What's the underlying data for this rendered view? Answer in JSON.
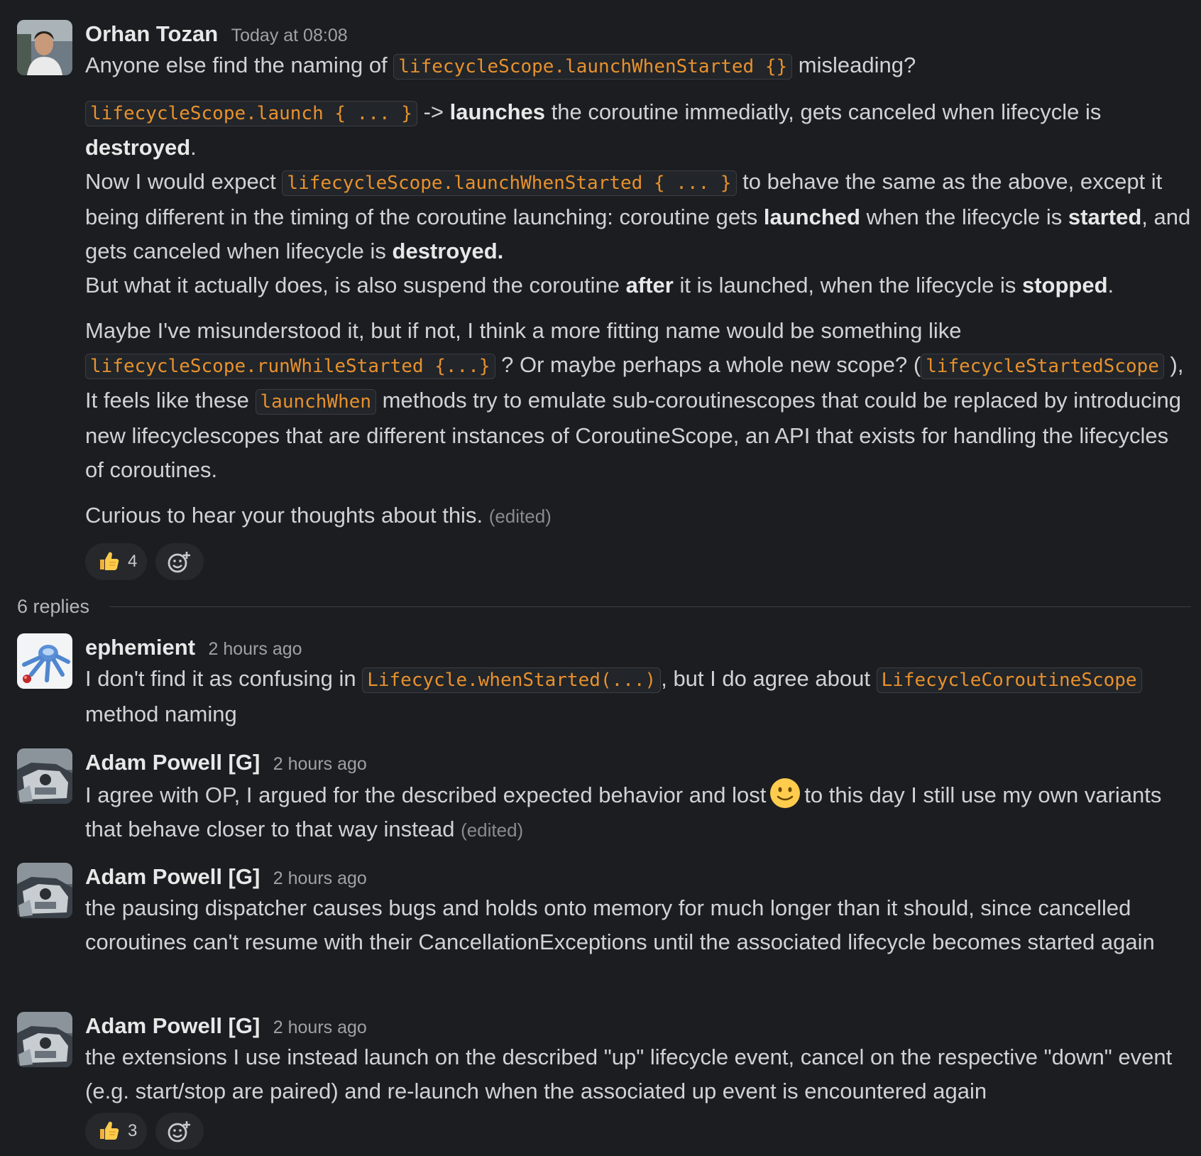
{
  "messages": [
    {
      "author": "Orhan Tozan",
      "timestamp": "Today at 08:08",
      "p1": {
        "t1": "Anyone else find the naming of ",
        "c1": "lifecycleScope.launchWhenStarted {}",
        "t2": " misleading?"
      },
      "p2": {
        "c1": "lifecycleScope.launch { ... }",
        "t1": " -> ",
        "b1": "launches",
        "t2": " the coroutine immediatly, gets canceled when lifecycle is ",
        "b2": "destroyed",
        "t3": ".",
        "t4": "Now I would expect ",
        "c2": "lifecycleScope.launchWhenStarted { ... }",
        "t5": " to behave the same as the above, except it being different in the timing of the coroutine launching: coroutine gets ",
        "b3": "launched",
        "t6": " when the lifecycle is ",
        "b4": "started",
        "t7": ", and gets canceled when lifecycle is ",
        "b5": "destroyed.",
        "t8": "But what it actually does, is also suspend the coroutine ",
        "b6": "after",
        "t9": " it is launched, when the lifecycle is ",
        "b7": "stopped",
        "t10": "."
      },
      "p3": {
        "t1": "Maybe I've misunderstood it, but if not, I think a more fitting name would be something like ",
        "c1": "lifecycleScope.runWhileStarted {...}",
        "t2": " ? Or maybe perhaps a whole new scope? (",
        "c2": "lifecycleStartedScope",
        "t3": " ), It feels like these ",
        "c3": "launchWhen",
        "t4": " methods  try to emulate sub-coroutinescopes that could be replaced by introducing new lifecyclescopes that are different instances of CoroutineScope, an API that exists for handling the lifecycles of coroutines."
      },
      "p4": {
        "t1": "Curious to hear your thoughts about this.",
        "edited": "(edited)"
      },
      "reactions": [
        {
          "emoji": "thumbs-up",
          "count": "4"
        }
      ]
    },
    {
      "author": "ephemient",
      "timestamp": "2 hours ago",
      "t1": "I don't find it as confusing in ",
      "c1": "Lifecycle.whenStarted(...)",
      "t2": ", but I do agree about ",
      "c2": "LifecycleCoroutineScope",
      "t3": " method naming"
    },
    {
      "author": "Adam Powell [G]",
      "timestamp": "2 hours ago",
      "t1": "I agree with OP, I argued for the described expected behavior and lost",
      "emoji": "slightly-smiling-face",
      "t2": "to this day I still use my own variants that behave closer to that way instead",
      "edited": "(edited)"
    },
    {
      "author": "Adam Powell [G]",
      "timestamp": "2 hours ago",
      "text": "the pausing dispatcher causes bugs and holds onto memory for much longer than it should, since cancelled coroutines can't resume with their CancellationExceptions until the associated lifecycle becomes started again"
    },
    {
      "author": "Adam Powell [G]",
      "timestamp": "2 hours ago",
      "text": "the extensions I use instead launch on the described \"up\" lifecycle event, cancel on the respective \"down\" event (e.g. start/stop are paired) and re-launch when the associated up event is encountered again",
      "reactions": [
        {
          "emoji": "thumbs-up",
          "count": "3"
        }
      ]
    }
  ],
  "thread": {
    "replies_label": "6 replies"
  },
  "colors": {
    "background": "#1b1d21",
    "text": "#d1d2d3",
    "code_text": "#e8912d",
    "timestamp": "#a0a1a4"
  },
  "icons": {
    "add_reaction": "add-reaction-icon",
    "thumbs_up": "thumbs-up-emoji"
  }
}
